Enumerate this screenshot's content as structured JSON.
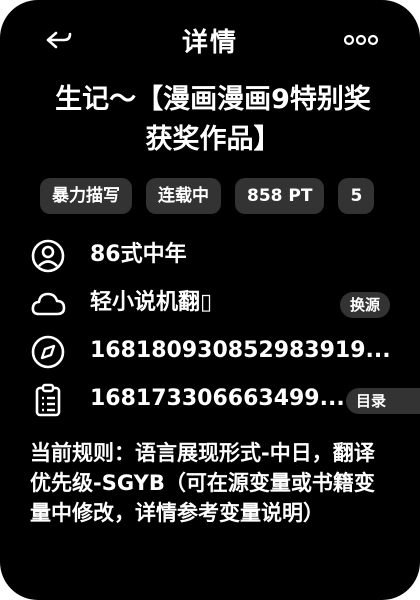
{
  "header": {
    "title": "详情",
    "back_icon": "back-arrow-icon",
    "more_icon": "more-dots-icon"
  },
  "book": {
    "title_line1": "生记～【漫画漫画9特别奖",
    "title_line2": "获奖作品】"
  },
  "tags": [
    "暴力描写",
    "连载中",
    "858 PT",
    "5"
  ],
  "info": {
    "author": {
      "text": "86式中年",
      "icon": "user-circle-icon"
    },
    "source": {
      "text": "轻小说机翻▯",
      "icon": "cloud-icon",
      "button": "换源"
    },
    "update": {
      "text": "16818093085298391­9...",
      "icon": "compass-icon"
    },
    "latest": {
      "text": "168173306663499...",
      "icon": "clipboard-list-icon",
      "button": "目录"
    }
  },
  "rule": {
    "text": "当前规则：语言展现形式-中日，翻译优先级-SGYB（可在源变量或书籍变量中修改，详情参考变量说明）"
  }
}
